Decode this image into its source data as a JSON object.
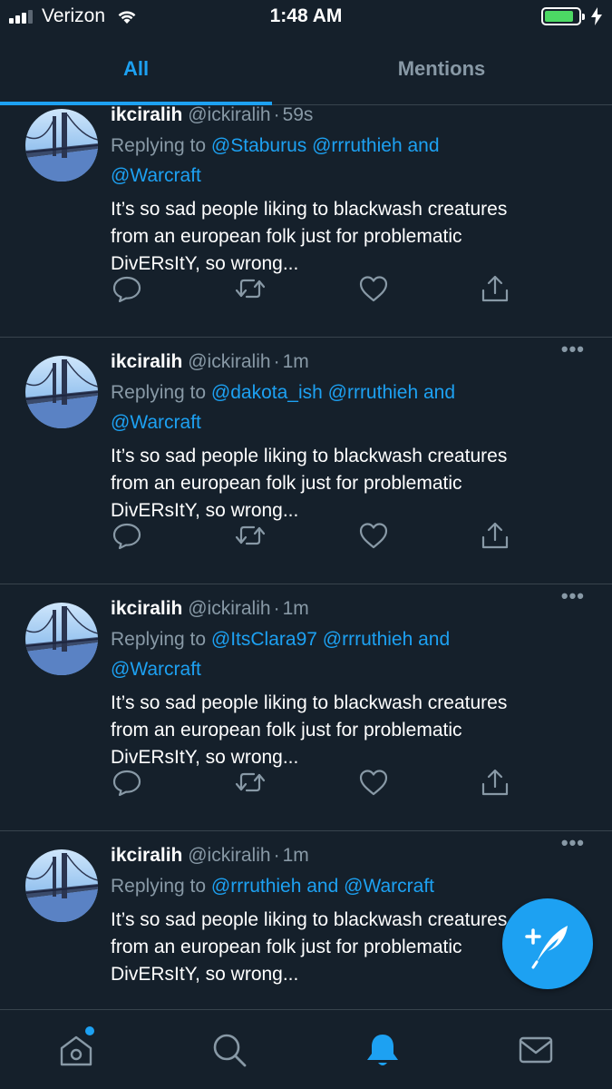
{
  "status_bar": {
    "carrier": "Verizon",
    "time": "1:48 AM",
    "battery_level": 0.85,
    "battery_color": "#4cd964"
  },
  "tabs": [
    {
      "label": "All",
      "active": true
    },
    {
      "label": "Mentions",
      "active": false
    }
  ],
  "tweets": [
    {
      "name": "ikciralih",
      "handle": "@ickiralih",
      "separator": "·",
      "time": "59s",
      "replying_prefix": "Replying to",
      "mentions_line1": "@Staburus @rrruthieh and",
      "mentions_line2": "@Warcraft",
      "text_line1": "It’s so sad people liking to blackwash creatures",
      "text_line2": "from an european folk just for problematic",
      "text_line3": "DivERsItY, so wrong...",
      "more": "•••"
    },
    {
      "name": "ikciralih",
      "handle": "@ickiralih",
      "separator": "·",
      "time": "1m",
      "replying_prefix": "Replying to",
      "mentions_line1": "@dakota_ish @rrruthieh and",
      "mentions_line2": "@Warcraft",
      "text_line1": "It’s so sad people liking to blackwash creatures",
      "text_line2": "from an european folk just for problematic",
      "text_line3": "DivERsItY, so wrong...",
      "more": "•••"
    },
    {
      "name": "ikciralih",
      "handle": "@ickiralih",
      "separator": "·",
      "time": "1m",
      "replying_prefix": "Replying to",
      "mentions_line1": "@ItsClara97 @rrruthieh and",
      "mentions_line2": "@Warcraft",
      "text_line1": "It’s so sad people liking to blackwash creatures",
      "text_line2": "from an european folk just for problematic",
      "text_line3": "DivERsItY, so wrong...",
      "more": "•••"
    },
    {
      "name": "ikciralih",
      "handle": "@ickiralih",
      "separator": "·",
      "time": "1m",
      "replying_prefix": "Replying to",
      "mentions_line1": "@rrruthieh and @Warcraft",
      "mentions_line2": "",
      "text_line1": "It’s so sad people liking to blackwash creatures",
      "text_line2": "from an european folk just for problematic",
      "text_line3": "DivERsItY, so wrong...",
      "more": "•••"
    }
  ],
  "icons": {
    "reply": "reply-icon",
    "retweet": "retweet-icon",
    "like": "heart-icon",
    "share": "share-icon",
    "compose": "compose-tweet-icon",
    "nav": [
      "home-icon",
      "search-icon",
      "notifications-bell-icon",
      "messages-envelope-icon"
    ]
  },
  "colors": {
    "background": "#15202b",
    "accent": "#1da1f2",
    "secondary_text": "#8899a6",
    "divider": "#38444d"
  }
}
